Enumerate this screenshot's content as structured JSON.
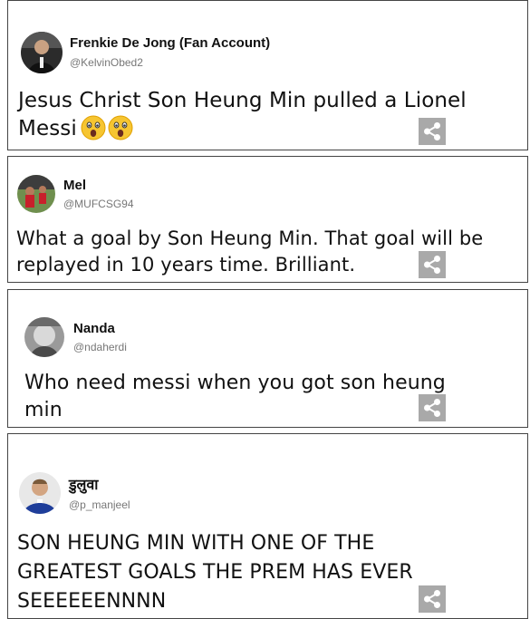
{
  "tweets": [
    {
      "name": "Frenkie De Jong (Fan Account)",
      "handle": "@KelvinObed2",
      "text": "Jesus Christ Son Heung Min pulled a Lionel Messi",
      "emojis": [
        "astonished-face-emoji",
        "astonished-face-emoji"
      ]
    },
    {
      "name": "Mel",
      "handle": "@MUFCSG94",
      "text": "What a goal by Son Heung Min. That goal will be replayed in 10 years time. Brilliant."
    },
    {
      "name": "Nanda",
      "handle": "@ndaherdi",
      "text": "Who need messi when you got son heung min"
    },
    {
      "name": "डुलुवा",
      "handle": "@p_manjeel",
      "text": "SON HEUNG MIN WITH ONE OF THE GREATEST GOALS THE PREM HAS EVER SEEEEEENNNN"
    }
  ],
  "share_icon": "share-icon",
  "colors": {
    "share_bg": "#a9a9a9",
    "border": "#444444",
    "handle": "#777777"
  }
}
